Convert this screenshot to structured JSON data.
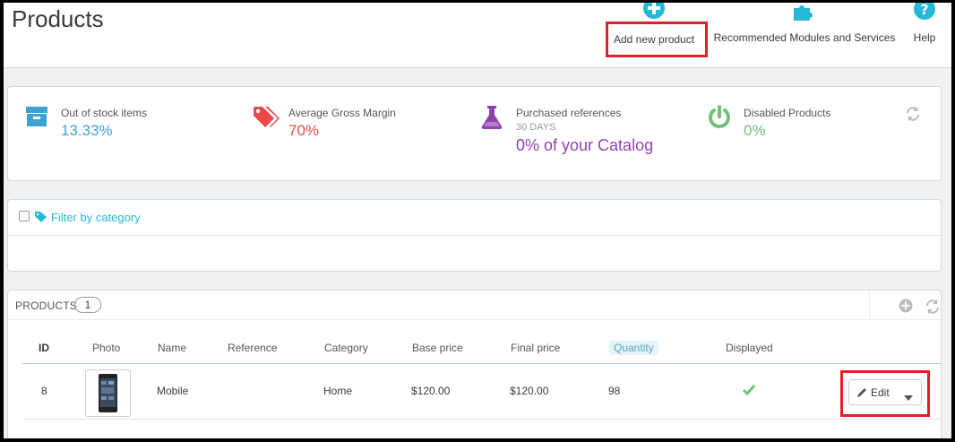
{
  "header": {
    "title": "Products",
    "toolbar": {
      "add_label": "Add new product",
      "modules_label": "Recommended Modules and Services",
      "help_label": "Help"
    }
  },
  "kpis": [
    {
      "label": "Out of stock items",
      "sub": "",
      "value": "13.33%",
      "color": "#3ea3d4",
      "icon": "archive-box-icon"
    },
    {
      "label": "Average Gross Margin",
      "sub": "",
      "value": "70%",
      "color": "#e84a4a",
      "icon": "tags-icon"
    },
    {
      "label": "Purchased references",
      "sub": "30 DAYS",
      "value": "0% of your Catalog",
      "color": "#8e44ad",
      "icon": "flask-icon"
    },
    {
      "label": "Disabled Products",
      "sub": "",
      "value": "0%",
      "color": "#72c279",
      "icon": "power-icon"
    }
  ],
  "filter": {
    "label": "Filter by category"
  },
  "products": {
    "title": "PRODUCTS",
    "count": "1",
    "columns": [
      "ID",
      "Photo",
      "Name",
      "Reference",
      "Category",
      "Base price",
      "Final price",
      "Quantity",
      "Displayed"
    ],
    "rows": [
      {
        "id": "8",
        "name": "Mobile",
        "reference": "",
        "category": "Home",
        "base_price": "$120.00",
        "final_price": "$120.00",
        "quantity": "98",
        "displayed": true,
        "action": "Edit"
      }
    ]
  },
  "colors": {
    "accent": "#25b9d7",
    "highlight": "#e0202a",
    "success": "#72c279"
  }
}
